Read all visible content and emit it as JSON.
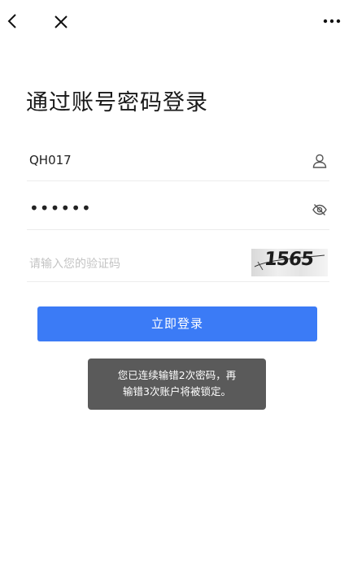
{
  "nav": {
    "back_icon": "chevron-left-icon",
    "close_icon": "close-icon",
    "more_icon": "more-horizontal-icon"
  },
  "title": "通过账号密码登录",
  "form": {
    "username": {
      "value": "QH017",
      "icon": "user-icon"
    },
    "password": {
      "value": "••••••",
      "icon": "eye-slash-icon"
    },
    "captcha": {
      "placeholder": "请输入您的验证码",
      "code": "1565"
    }
  },
  "login_button": "立即登录",
  "toast": {
    "line1": "您已连续输错2次密码，再",
    "line2": "输错3次账户将被锁定。"
  },
  "colors": {
    "primary": "#3b7bf6",
    "toast_bg": "#5a5a5a"
  }
}
